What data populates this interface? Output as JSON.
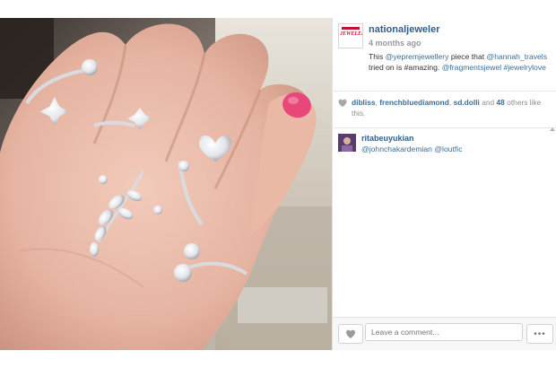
{
  "post": {
    "username": "nationaljeweler",
    "timestamp": "4 months ago",
    "avatar_logo_text": "JEWELER",
    "caption": {
      "prefix": "This",
      "mention1": "@yepremjewellery",
      "mid1": "piece that",
      "mention2": "@hannah_travels",
      "mid2": "tried on is #amazing.",
      "mention3": "@fragmentsjewel",
      "hashtag": "#jewelrylove"
    },
    "likes": {
      "users": [
        "dibliss",
        "frenchbluediamond",
        "sd.dolli"
      ],
      "sep1": ",",
      "sep2": ",",
      "and": "and",
      "count": "48",
      "suffix": "others like this."
    },
    "comments": [
      {
        "username": "ritabeuyukian",
        "text": "@johnchakardemian @loutfic"
      }
    ]
  },
  "footer": {
    "comment_placeholder": "Leave a comment...",
    "more_label": "•••"
  },
  "icons": {
    "like": "heart-icon",
    "more": "more-dots-icon"
  },
  "colors": {
    "link": "#3b6e99",
    "username": "#2f5f8a",
    "muted": "#999999",
    "brand": "#c8102e"
  }
}
